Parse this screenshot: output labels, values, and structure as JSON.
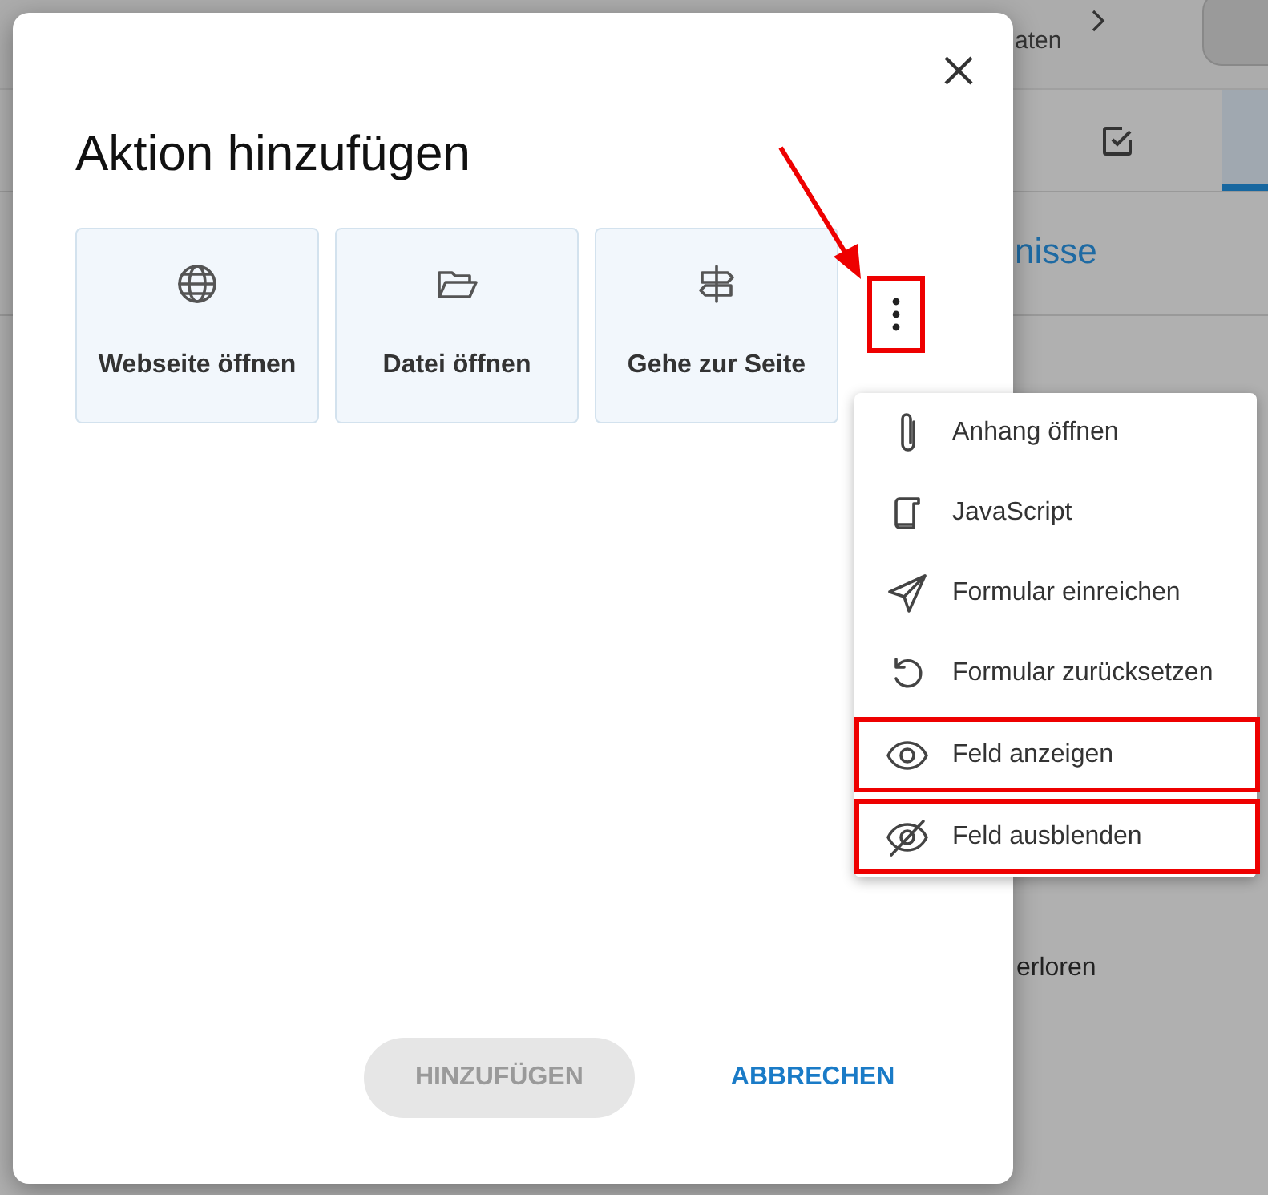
{
  "background": {
    "toolbar_text": "aten",
    "section_heading": "nisse",
    "list_text": "erloren"
  },
  "dialog": {
    "title": "Aktion hinzufügen",
    "actions": [
      {
        "label": "Webseite öffnen"
      },
      {
        "label": "Datei öffnen"
      },
      {
        "label": "Gehe zur Seite"
      }
    ],
    "more_button": {
      "highlighted": true
    },
    "buttons": [
      {
        "label": "HINZUFÜGEN",
        "kind": "filled",
        "disabled": true
      },
      {
        "label": "ABBRECHEN",
        "kind": "text",
        "disabled": false
      }
    ]
  },
  "menu": [
    {
      "label": "Anhang öffnen",
      "highlighted": false
    },
    {
      "label": "JavaScript",
      "highlighted": false
    },
    {
      "label": "Formular einreichen",
      "highlighted": false
    },
    {
      "label": "Formular zurücksetzen",
      "highlighted": false
    },
    {
      "label": "Feld anzeigen",
      "highlighted": true
    },
    {
      "label": "Feld ausblenden",
      "highlighted": true
    }
  ]
}
